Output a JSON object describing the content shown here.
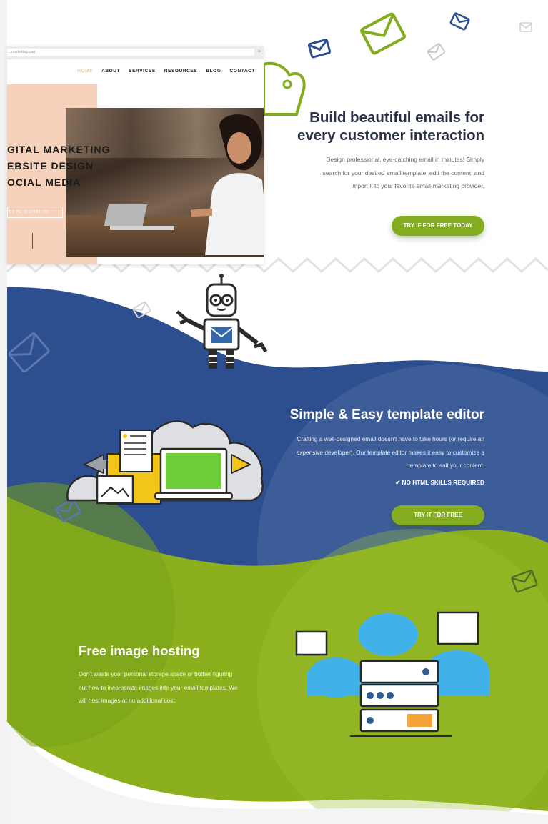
{
  "mockup": {
    "url": "...marketing.com",
    "menu_icon": "hamburger-icon",
    "nav": [
      "HOME",
      "ABOUT",
      "SERVICES",
      "RESOURCES",
      "BLOG",
      "CONTACT"
    ],
    "headline_lines": [
      "GITAL MARKETING",
      "EBSITE DESIGN",
      "OCIAL MEDIA"
    ],
    "button": "ET BE DIGITAL CO."
  },
  "hero": {
    "title_line1": "Build beautiful emails for",
    "title_line2": "every customer interaction",
    "text_line1": "Design professional, eye-catching email in minutes! Simply",
    "text_line2": "search for your desired email template, edit the content, and",
    "text_line3": "import it to your favorite email-marketing provider.",
    "cta": "TRY IF FOR FREE TODAY"
  },
  "editor": {
    "title": "Simple & Easy template editor",
    "text_line1": "Crafting a well-designed email doesn't have to take hours (or require an",
    "text_line2": "expensive developer).  Our template editor makes it easy to customize a",
    "text_line3": "template to suit your content.",
    "check_icon": "check-icon",
    "feature": "NO HTML SKILLS REQUIRED",
    "cta": "TRY IT FOR FREE"
  },
  "hosting": {
    "title": "Free image hosting",
    "text_line1": "Don't waste your personal storage space or bother figuring",
    "text_line2": "out how to incorporate images into your email templates.  We",
    "text_line3": "will host images at no additional cost."
  },
  "colors": {
    "navy": "#2e4f8f",
    "green": "#84ac20",
    "dark_text": "#2a3145",
    "peach": "#f6d2bd"
  }
}
